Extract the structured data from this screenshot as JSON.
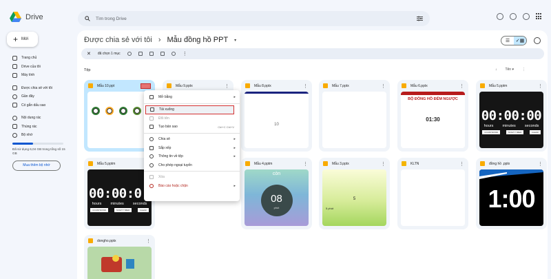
{
  "app": {
    "name": "Drive"
  },
  "search": {
    "placeholder": "Tìm trong Drive"
  },
  "sidebar": {
    "new_label": "Mới",
    "items": [
      {
        "label": "Trang chủ",
        "icon": "home-icon"
      },
      {
        "label": "Drive của tôi",
        "icon": "drive-icon"
      },
      {
        "label": "Máy tính",
        "icon": "computer-icon"
      },
      {
        "label": "Được chia sẻ với tôi",
        "icon": "shared-icon"
      },
      {
        "label": "Gần đây",
        "icon": "clock-icon"
      },
      {
        "label": "Có gắn dấu sao",
        "icon": "star-icon"
      },
      {
        "label": "Nội dung rác",
        "icon": "spam-icon"
      },
      {
        "label": "Thùng rác",
        "icon": "trash-icon"
      },
      {
        "label": "Bộ nhớ",
        "icon": "cloud-icon"
      }
    ],
    "storage_text": "Đã sử dụng 6,04 GB trong tổng số 15 GB",
    "storage_fraction": 0.4,
    "buy_label": "Mua thêm bộ nhớ"
  },
  "breadcrumb": {
    "parent": "Được chia sẻ với tôi",
    "sep": "›",
    "current": "Mẫu đồng hồ PPT"
  },
  "selection_bar": {
    "count_label": "đã chọn 1 mục"
  },
  "files_label": "Tệp",
  "sort_label": "Tên",
  "files": [
    {
      "name": "Mẫu 10.ppt",
      "type": "ppt",
      "selected": true
    },
    {
      "name": "Mẫu 9.pptx",
      "type": "pptx"
    },
    {
      "name": "Mẫu 8.pptx",
      "type": "pptx",
      "thumb_text": "10"
    },
    {
      "name": "Mẫu 7.pptx",
      "type": "pptx"
    },
    {
      "name": "Mẫu 6.pptx",
      "type": "pptx",
      "thumb_title": "BỘ ĐỒNG HỒ ĐẾM NGƯỢC",
      "thumb_time": "01:30"
    },
    {
      "name": "Mẫu 5.pptm",
      "type": "pptm",
      "thumb_time": "00:00:00",
      "units": [
        "hours",
        "minutes",
        "seconds"
      ],
      "btns": [
        "COUNTDOWN",
        "START TIMER",
        "CLEAR"
      ]
    },
    {
      "name": "Mẫu 5.pptm",
      "type": "pptm",
      "thumb_time": "00:00:0",
      "units": [
        "hours",
        "minutes",
        "seconds"
      ],
      "btns": [
        "COUNTDOWN",
        "START TIMER",
        "CLEAR"
      ]
    },
    {
      "name": "Mẫu 4.pptm",
      "type": "pptm",
      "thumb_top": "còn",
      "thumb_num": "08",
      "thumb_sub": "phút"
    },
    {
      "name": "Mẫu 3.pptx",
      "type": "pptx",
      "thumb_num": "5",
      "thumb_sub": "5 phút"
    },
    {
      "name": "KLTN",
      "type": "slides"
    },
    {
      "name": "đồng hồ .pptx",
      "type": "pptx",
      "thumb_time": "1:00"
    },
    {
      "name": "dongho.pptx",
      "type": "pptx"
    }
  ],
  "context_menu": [
    {
      "label": "Mở bằng",
      "arrow": true,
      "icon": "open-with-icon"
    },
    {
      "sep": true
    },
    {
      "label": "Tải xuống",
      "icon": "download-icon",
      "highlight": true
    },
    {
      "label": "Đổi tên",
      "icon": "rename-icon",
      "dim": true
    },
    {
      "label": "Tạo bản sao",
      "icon": "copy-icon",
      "shortcut": "Ctrl+C Ctrl+V"
    },
    {
      "sep": true
    },
    {
      "label": "Chia sẻ",
      "arrow": true,
      "icon": "share-icon"
    },
    {
      "label": "Sắp xếp",
      "arrow": true,
      "icon": "folder-icon"
    },
    {
      "label": "Thông tin về tệp",
      "arrow": true,
      "icon": "info-icon"
    },
    {
      "label": "Cho phép ngoại tuyến",
      "icon": "offline-icon"
    },
    {
      "sep": true
    },
    {
      "label": "Xóa",
      "icon": "delete-icon",
      "dim": true
    },
    {
      "label": "Báo cáo hoặc chặn",
      "arrow": true,
      "icon": "report-icon",
      "red": true
    }
  ]
}
